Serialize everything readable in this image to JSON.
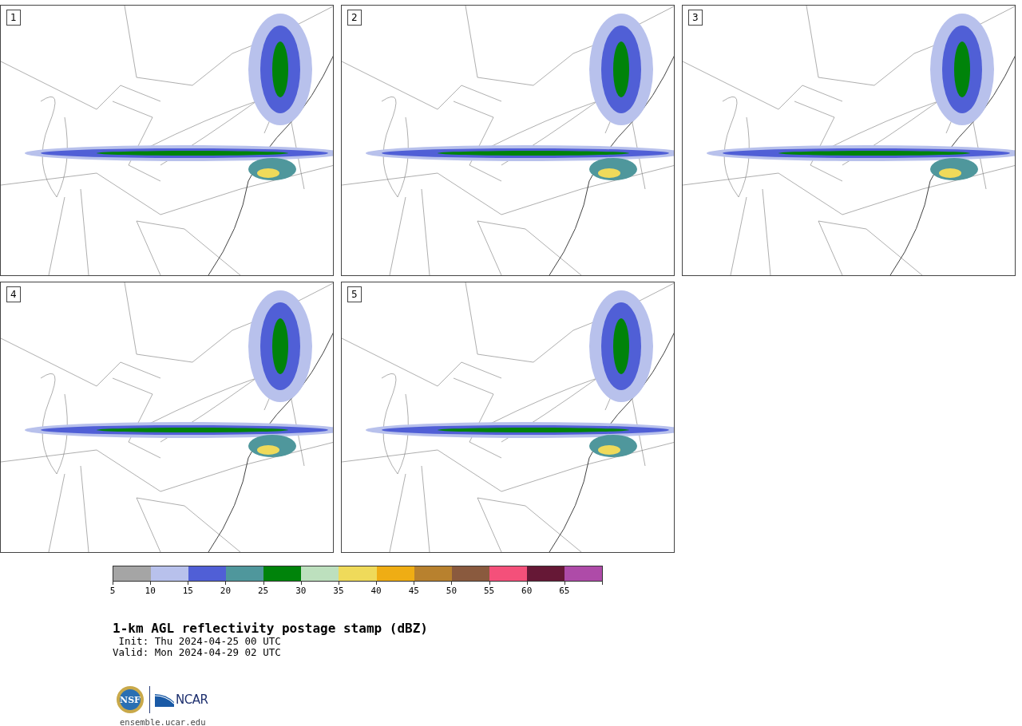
{
  "panels": [
    {
      "label": "1"
    },
    {
      "label": "2"
    },
    {
      "label": "3"
    },
    {
      "label": "4"
    },
    {
      "label": "5"
    }
  ],
  "colorbar": [
    {
      "color": "#a5a5a5",
      "tick": "5"
    },
    {
      "color": "#b8c1ec",
      "tick": "10"
    },
    {
      "color": "#505fd6",
      "tick": "15"
    },
    {
      "color": "#4f979c",
      "tick": "20"
    },
    {
      "color": "#00830a",
      "tick": "25"
    },
    {
      "color": "#bde0be",
      "tick": "30"
    },
    {
      "color": "#efda5a",
      "tick": "35"
    },
    {
      "color": "#efad14",
      "tick": "40"
    },
    {
      "color": "#b8812e",
      "tick": "45"
    },
    {
      "color": "#8a5a3e",
      "tick": "50"
    },
    {
      "color": "#f4507a",
      "tick": "55"
    },
    {
      "color": "#661836",
      "tick": "60"
    },
    {
      "color": "#ae4ba8",
      "tick": "65"
    }
  ],
  "title": "1-km AGL reflectivity postage stamp (dBZ)",
  "init": " Init: Thu 2024-04-25 00 UTC",
  "valid": "Valid: Mon 2024-04-29 02 UTC",
  "logos": {
    "nsf": "NSF",
    "ncar": "NCAR"
  },
  "site": "ensemble.ucar.edu"
}
